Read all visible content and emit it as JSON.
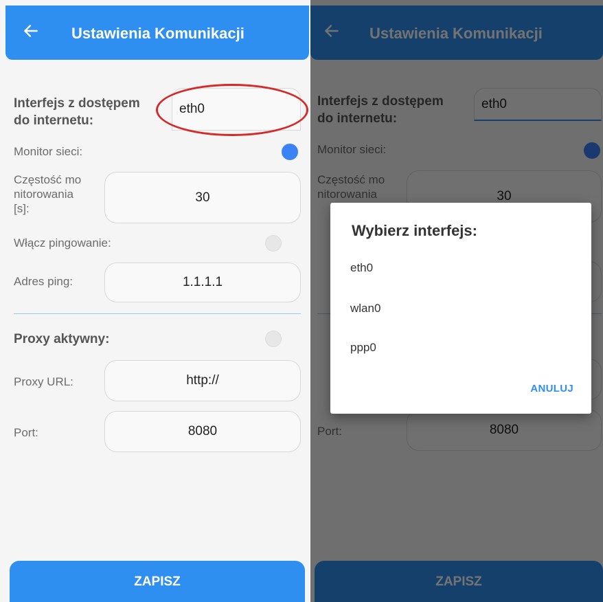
{
  "screen": {
    "title": "Ustawienia Komunikacji",
    "save_label": "ZAPISZ"
  },
  "form": {
    "interface_label": "Interfejs z dostępem do internetu:",
    "interface_label_line1": "Interfejs z dostępem",
    "interface_label_line2": "do internetu:",
    "interface_value": "eth0",
    "monitor_label": "Monitor sieci:",
    "monitor_enabled": true,
    "frequency_label_line1": "Częstość mo",
    "frequency_label_line2": "nitorowania",
    "frequency_label_line3": "[s]:",
    "frequency_value": "30",
    "ping_label": "Włącz pingowanie:",
    "ping_enabled": false,
    "ping_address_label": "Adres ping:",
    "ping_address_value": "1.1.1.1",
    "proxy_label": "Proxy aktywny:",
    "proxy_enabled": false,
    "proxy_url_label": "Proxy URL:",
    "proxy_url_value": "http://",
    "port_label": "Port:",
    "port_value": "8080"
  },
  "dialog": {
    "title": "Wybierz interfejs:",
    "options": [
      "eth0",
      "wlan0",
      "ppp0"
    ],
    "cancel_label": "ANULUJ"
  },
  "colors": {
    "primary": "#2f8ff0",
    "toggle_on": "#3b82f6",
    "highlight": "#d42a2a"
  },
  "icons": {
    "back": "arrow-left-icon"
  }
}
